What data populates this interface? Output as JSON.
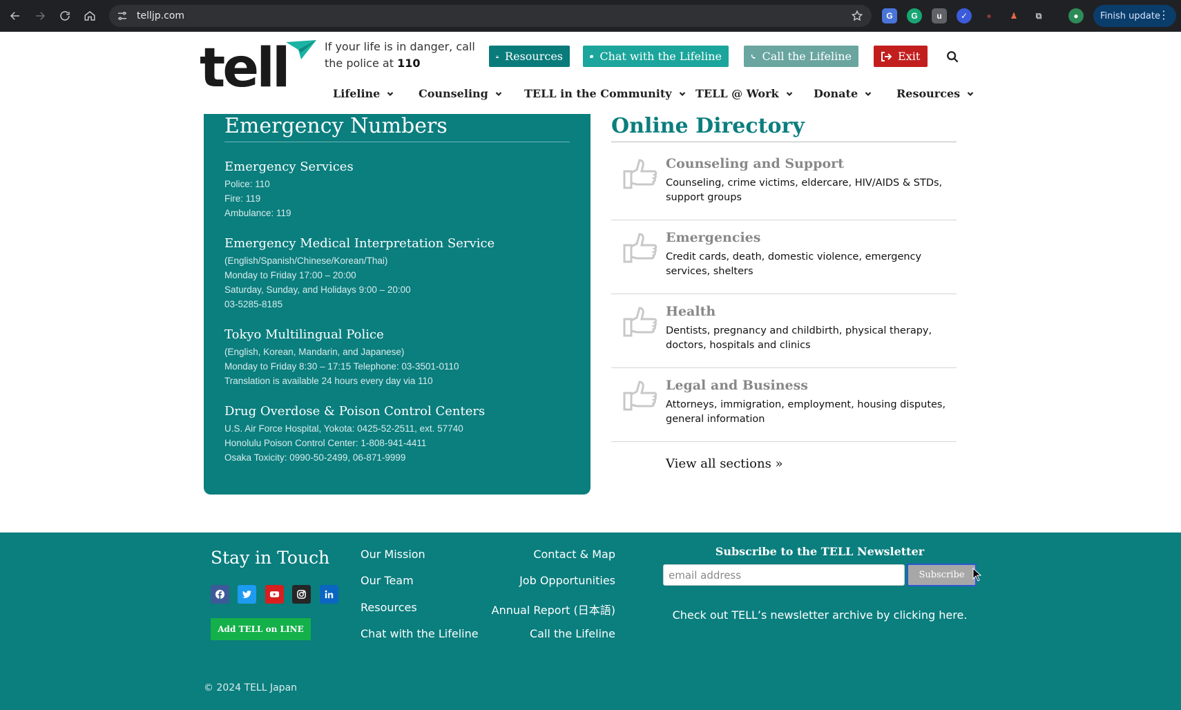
{
  "browser": {
    "url": "telljp.com",
    "finish_update_label": "Finish update",
    "colors": {
      "chrome_bg": "#202124",
      "omnibox_bg": "#303134"
    }
  },
  "header": {
    "logo_text": "tell",
    "danger_line1": "If your life is in danger, call",
    "danger_line2_prefix": "the police at ",
    "danger_number": "110",
    "buttons": {
      "resources": "Resources",
      "chat": "Chat with the Lifeline",
      "call": "Call the Lifeline",
      "exit": "Exit"
    },
    "nav": [
      {
        "label": "Lifeline"
      },
      {
        "label": "Counseling"
      },
      {
        "label": "TELL in the Community"
      },
      {
        "label": "TELL @ Work"
      },
      {
        "label": "Donate"
      },
      {
        "label": "Resources"
      }
    ]
  },
  "emergency": {
    "title": "Emergency Numbers",
    "blocks": [
      {
        "title": "Emergency Services",
        "lines": [
          "Police: 110",
          "Fire: 119",
          "Ambulance: 119"
        ]
      },
      {
        "title": "Emergency Medical Interpretation Service",
        "lines": [
          "(English/Spanish/Chinese/Korean/Thai)",
          "Monday to Friday 17:00 – 20:00",
          "Saturday, Sunday, and Holidays 9:00 – 20:00",
          "03-5285-8185"
        ]
      },
      {
        "title": "Tokyo Multilingual Police",
        "lines": [
          "(English, Korean, Mandarin, and Japanese)",
          "Monday to Friday 8:30 – 17:15 Telephone: 03-3501-0110",
          "Translation is available 24 hours every day via 110"
        ]
      },
      {
        "title": "Drug Overdose & Poison Control Centers",
        "lines": [
          "U.S. Air Force Hospital, Yokota: 0425-52-2511, ext. 57740",
          "Honolulu Poison Control Center: 1-808-941-4411",
          "Osaka Toxicity: 0990-50-2499, 06-871-9999"
        ]
      }
    ]
  },
  "directory": {
    "title": "Online Directory",
    "items": [
      {
        "title": "Counseling and Support",
        "desc": "Counseling, crime victims, eldercare, HIV/AIDS & STDs, support groups"
      },
      {
        "title": "Emergencies",
        "desc": "Credit cards, death, domestic violence, emergency services, shelters"
      },
      {
        "title": "Health",
        "desc": "Dentists, pregnancy and childbirth, physical therapy, doctors, hospitals and clinics"
      },
      {
        "title": "Legal and Business",
        "desc": "Attorneys, immigration, employment, housing disputes, general information"
      }
    ],
    "view_all": "View all sections »"
  },
  "footer": {
    "stay_in_touch": "Stay in Touch",
    "line_button": "Add TELL on LINE",
    "links_col1": [
      "Our Mission",
      "Our Team",
      "Resources",
      "Chat with the Lifeline"
    ],
    "links_col2": [
      "Contact & Map",
      "Job Opportunities",
      "Annual Report (日本語)",
      "Call the Lifeline"
    ],
    "newsletter_title": "Subscribe to the TELL Newsletter",
    "email_placeholder": "email address",
    "subscribe_label": "Subscribe",
    "archive_text": "Check out TELL’s newsletter archive by clicking here.",
    "copyright": "© 2024 TELL Japan"
  },
  "colors": {
    "teal": "#0b7e7e",
    "resources_btn": "#0a7b7b",
    "chat_btn": "#1ba59c",
    "call_btn": "#6aa5a0",
    "exit_btn": "#c31e1e",
    "line_green": "#14b04a"
  }
}
